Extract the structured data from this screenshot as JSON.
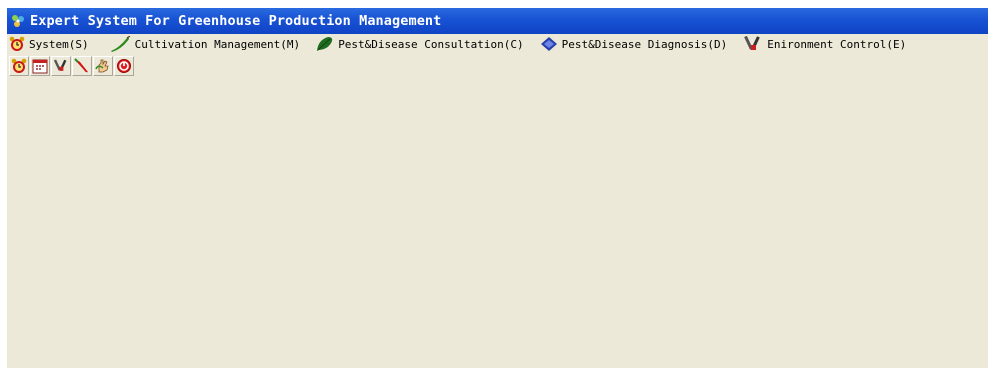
{
  "window": {
    "title": "Expert System For Greenhouse Production Management"
  },
  "menubar": {
    "items": [
      {
        "label": "System(S)",
        "icon": "alarm-clock-icon"
      },
      {
        "label": "Cultivation Management(M)",
        "icon": "cucumber-icon"
      },
      {
        "label": "Pest&Disease Consultation(C)",
        "icon": "leaf-icon"
      },
      {
        "label": "Pest&Disease Diagnosis(D)",
        "icon": "book-icon"
      },
      {
        "label": "Enironment Control(E)",
        "icon": "tools-icon"
      }
    ]
  },
  "toolbar": {
    "buttons": [
      {
        "icon": "alarm-clock-icon"
      },
      {
        "icon": "calendar-icon"
      },
      {
        "icon": "tools-icon"
      },
      {
        "icon": "red-pepper-icon"
      },
      {
        "icon": "hand-icon"
      },
      {
        "icon": "exit-icon"
      }
    ]
  },
  "colors": {
    "titlebar": "#1852d4",
    "background": "#ece9d8"
  }
}
